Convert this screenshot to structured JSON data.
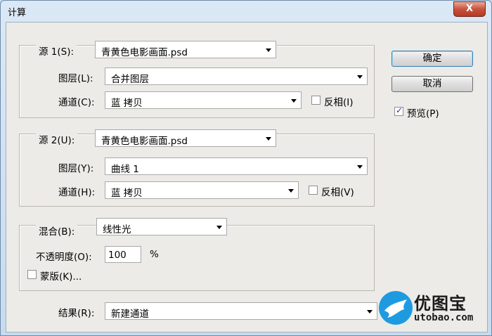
{
  "window": {
    "title": "计算",
    "close_symbol": "X"
  },
  "source1": {
    "label": "源 1(S):",
    "file": "青黄色电影画面.psd",
    "layer_label": "图层(L):",
    "layer": "合并图层",
    "channel_label": "通道(C):",
    "channel": "蓝 拷贝",
    "invert_label": "反相(I)",
    "invert_checked": false
  },
  "source2": {
    "label": "源 2(U):",
    "file": "青黄色电影画面.psd",
    "layer_label": "图层(Y):",
    "layer": "曲线 1",
    "channel_label": "通道(H):",
    "channel": "蓝 拷贝",
    "invert_label": "反相(V)",
    "invert_checked": false
  },
  "blend": {
    "label": "混合(B):",
    "mode": "线性光",
    "opacity_label": "不透明度(O):",
    "opacity": "100",
    "opacity_unit": "%",
    "mask_label": "蒙版(K)...",
    "mask_checked": false
  },
  "result": {
    "label": "结果(R):",
    "value": "新建通道"
  },
  "buttons": {
    "ok": "确定",
    "cancel": "取消"
  },
  "preview": {
    "label": "预览(P)",
    "checked": true,
    "check_symbol": "✓"
  },
  "watermark": {
    "name": "优图宝",
    "url": "utobao.com"
  }
}
